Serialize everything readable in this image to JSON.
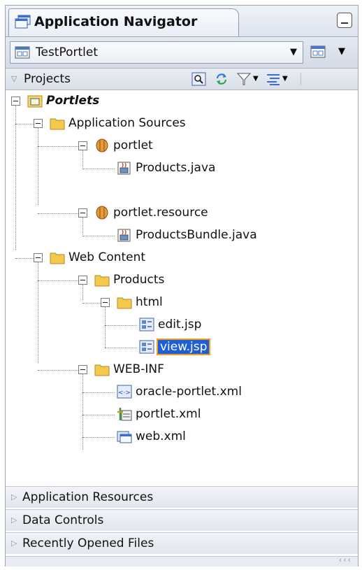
{
  "tab": {
    "title": "Application Navigator",
    "icon": "application-navigator-icon"
  },
  "application": {
    "selected": "TestPortlet",
    "icon": "application-icon"
  },
  "projects": {
    "label": "Projects"
  },
  "toolbar": {
    "icons": [
      "find-icon",
      "refresh-icon",
      "filter-icon",
      "sort-icon"
    ]
  },
  "tree": {
    "root": "Portlets",
    "application_sources": "Application Sources",
    "pkg_portlet": "portlet",
    "products_java": "Products.java",
    "pkg_portlet_resource": "portlet.resource",
    "products_bundle": "ProductsBundle.java",
    "web_content": "Web Content",
    "products_folder": "Products",
    "html_folder": "html",
    "edit_jsp": "edit.jsp",
    "view_jsp": "view.jsp",
    "web_inf": "WEB-INF",
    "oracle_portlet_xml": "oracle-portlet.xml",
    "portlet_xml": "portlet.xml",
    "web_xml": "web.xml"
  },
  "panels": {
    "app_resources": "Application Resources",
    "data_controls": "Data Controls",
    "recent_files": "Recently Opened Files"
  },
  "colors": {
    "selection": "#1f5fd6",
    "selection_outline": "#f0a020",
    "folder": "#f2c94c"
  }
}
